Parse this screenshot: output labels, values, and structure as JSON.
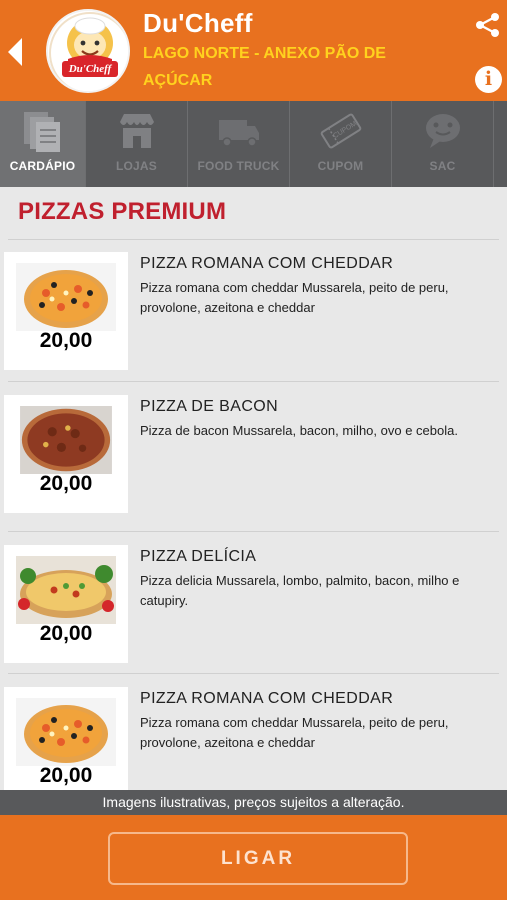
{
  "header": {
    "title": "Du'Cheff",
    "subtitle": "LAGO NORTE - ANEXO PÃO DE AÇÚCAR",
    "logo_text": "Du'Cheff",
    "brand_color": "#e8711f",
    "subtitle_color": "#ffd21e",
    "icons": [
      "back-arrow-icon",
      "share-icon",
      "info-icon"
    ]
  },
  "tabs": [
    {
      "label": "CARDÁPIO",
      "icon": "menu-list-icon",
      "active": true
    },
    {
      "label": "LOJAS",
      "icon": "store-icon",
      "active": false
    },
    {
      "label": "FOOD TRUCK",
      "icon": "truck-icon",
      "active": false
    },
    {
      "label": "CUPOM",
      "icon": "coupon-icon",
      "active": false
    },
    {
      "label": "SAC",
      "icon": "chat-icon",
      "active": false
    }
  ],
  "section": {
    "title": "PIZZAS PREMIUM",
    "title_color": "#c0202e"
  },
  "items": [
    {
      "name": "PIZZA ROMANA COM CHEDDAR",
      "description": "Pizza romana com cheddar Mussarela, peito de peru, provolone, azeitona e cheddar",
      "price": "20,00"
    },
    {
      "name": "PIZZA DE BACON",
      "description": "Pizza de bacon Mussarela, bacon, milho, ovo e cebola.",
      "price": "20,00"
    },
    {
      "name": "PIZZA DELÍCIA",
      "description": "Pizza delicia Mussarela, lombo, palmito, bacon, milho e catupiry.",
      "price": "20,00"
    },
    {
      "name": "PIZZA ROMANA COM CHEDDAR",
      "description": "Pizza romana com cheddar Mussarela, peito de peru, provolone, azeitona e cheddar",
      "price": "20,00"
    }
  ],
  "footer": {
    "disclaimer": "Imagens ilustrativas, preços sujeitos a alteração.",
    "call_label": "LIGAR"
  }
}
